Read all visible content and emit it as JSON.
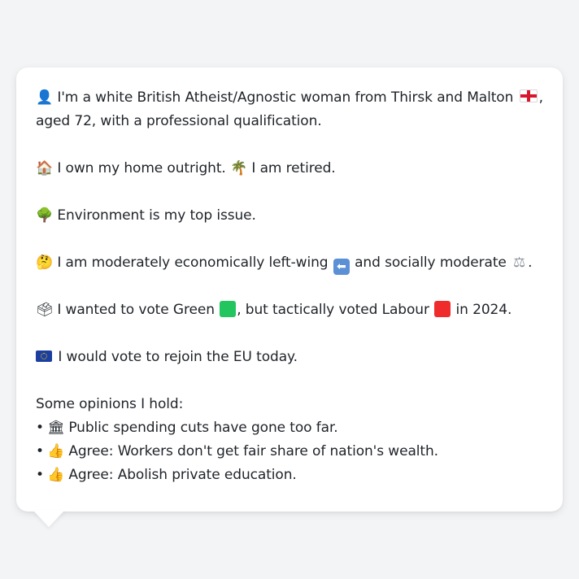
{
  "profile": {
    "identity": {
      "icon": "bust-silhouette-icon",
      "text_a": "I'm a white British Atheist/Agnostic woman from Thirsk and Malton",
      "flag": "england-flag-icon",
      "text_b": ",",
      "text_c": "aged 72, with a professional qualification."
    },
    "housing": {
      "icon1": "house-icon",
      "text1": "I own my home outright.",
      "icon2": "palm-tree-icon",
      "text2": "I am retired."
    },
    "issue": {
      "icon": "tree-icon",
      "text": "Environment is my top issue."
    },
    "politics": {
      "icon": "thinking-face-icon",
      "text_a": "I am moderately economically left-wing",
      "icon2": "left-arrow-icon",
      "text_b": "and socially moderate",
      "icon3": "balance-scale-icon",
      "text_c": "."
    },
    "vote": {
      "icon": "ballot-box-icon",
      "text_a": "I wanted to vote Green",
      "green_color": "#22c55e",
      "text_b": ", but tactically voted Labour",
      "red_color": "#ef2b2b",
      "text_c": "in 2024."
    },
    "eu": {
      "icon": "eu-flag-icon",
      "text": "I would vote to rejoin the EU today."
    },
    "opinions": {
      "heading": "Some opinions I hold:",
      "bullet": "•",
      "items": [
        {
          "icon": "classical-building-icon",
          "text": "Public spending cuts have gone too far."
        },
        {
          "icon": "thumbs-up-icon",
          "text": "Agree: Workers don't get fair share of nation's wealth."
        },
        {
          "icon": "thumbs-up-icon",
          "text": "Agree: Abolish private education."
        }
      ]
    }
  }
}
